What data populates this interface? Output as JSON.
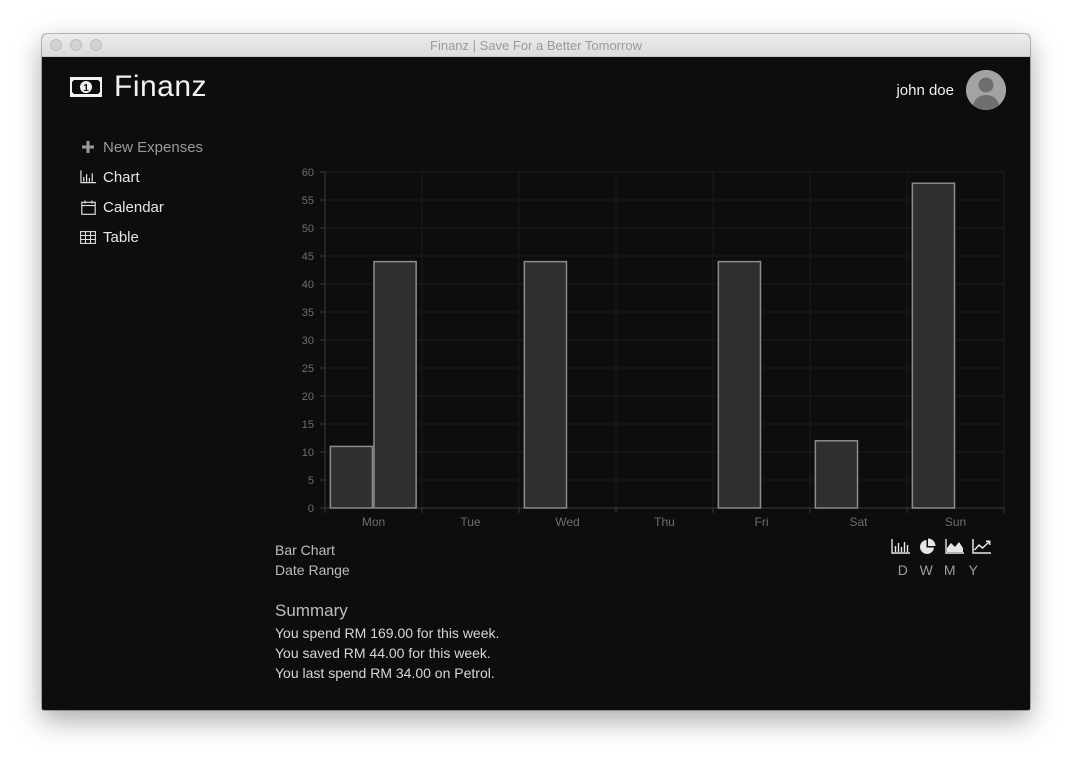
{
  "window": {
    "title": "Finanz | Save For a Better Tomorrow"
  },
  "brand": {
    "name": "Finanz",
    "icon": "money-bill-icon"
  },
  "user": {
    "name": "john doe",
    "avatar_icon": "user-avatar-icon"
  },
  "sidebar": {
    "items": [
      {
        "label": "New Expenses",
        "icon": "plus-icon"
      },
      {
        "label": "Chart",
        "icon": "bar-chart-icon"
      },
      {
        "label": "Calendar",
        "icon": "calendar-icon"
      },
      {
        "label": "Table",
        "icon": "table-icon"
      }
    ]
  },
  "chart_data": {
    "type": "bar",
    "categories": [
      "Mon",
      "Tue",
      "Wed",
      "Thu",
      "Fri",
      "Sat",
      "Sun"
    ],
    "series": [
      {
        "values": [
          11,
          0,
          44,
          0,
          44,
          12,
          58
        ]
      },
      {
        "values": [
          44,
          0,
          0,
          0,
          0,
          0,
          0
        ]
      }
    ],
    "ylim": [
      0,
      60
    ],
    "yticks": [
      0,
      5,
      10,
      15,
      20,
      25,
      30,
      35,
      40,
      45,
      50,
      55,
      60
    ],
    "grid": true,
    "colors": {
      "bar_fill": "#2f2f2f",
      "bar_stroke": "#8c8c8c",
      "axis_text": "#6e6e6e",
      "grid": "#1c1c1c"
    }
  },
  "chart_info": {
    "type_label": "Bar Chart",
    "range_label": "Date Range"
  },
  "chart_controls": {
    "types": [
      "bar-chart-icon",
      "pie-chart-icon",
      "area-chart-icon",
      "line-chart-icon"
    ],
    "ranges": [
      "D",
      "W",
      "M",
      "Y"
    ]
  },
  "summary": {
    "title": "Summary",
    "lines": [
      "You spend RM 169.00 for this week.",
      "You saved RM 44.00 for this week.",
      "You last spend RM 34.00 on Petrol."
    ]
  }
}
